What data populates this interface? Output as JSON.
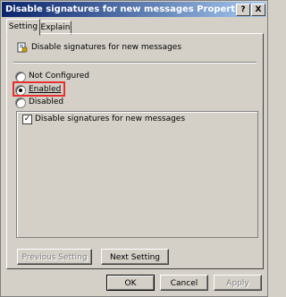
{
  "window": {
    "title": "Disable signatures for new messages Properties"
  },
  "titlebar_buttons": {
    "help": "?",
    "close": "X"
  },
  "tabs": [
    {
      "label": "Setting"
    },
    {
      "label": "Explain"
    }
  ],
  "policy": {
    "name": "Disable signatures for new messages",
    "icon": "policy-setting-icon"
  },
  "options": [
    {
      "label": "Not Configured",
      "selected": false
    },
    {
      "label": "Enabled",
      "selected": true
    },
    {
      "label": "Disabled",
      "selected": false
    }
  ],
  "checkbox": {
    "label": "Disable signatures for new messages",
    "checked": true,
    "mark": "✓"
  },
  "nav_buttons": {
    "previous": "Previous Setting",
    "next": "Next Setting"
  },
  "dialog_buttons": {
    "ok": "OK",
    "cancel": "Cancel",
    "apply": "Apply"
  },
  "colors": {
    "highlight": "#e53030",
    "titlebar_start": "#0a246a",
    "titlebar_end": "#a6caf0"
  }
}
